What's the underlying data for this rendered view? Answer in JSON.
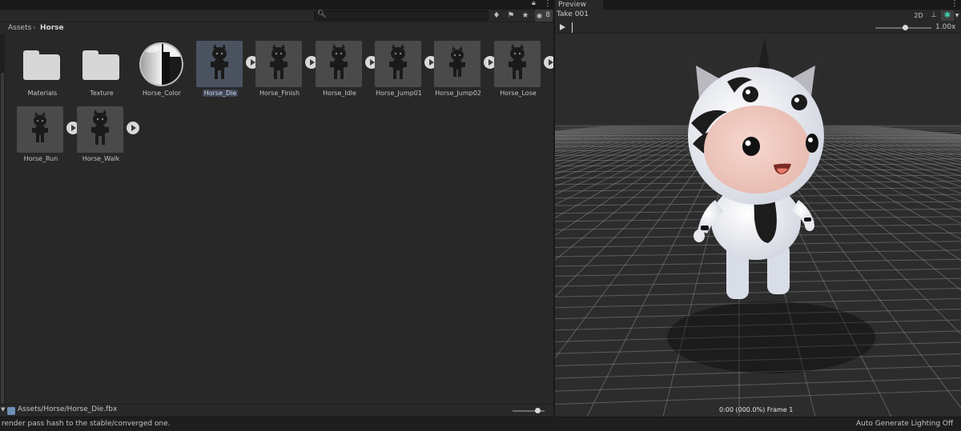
{
  "project": {
    "search": {
      "placeholder": "",
      "value": ""
    },
    "hidden_packages_count": "8",
    "breadcrumb": [
      "Assets",
      "Horse"
    ],
    "breadcrumb_separator": "›",
    "assets": [
      {
        "name": "Materials",
        "kind": "folder",
        "icon": "folder-icon"
      },
      {
        "name": "Texture",
        "kind": "folder",
        "icon": "folder-icon"
      },
      {
        "name": "Horse_Color",
        "kind": "material",
        "icon": "material-sphere-icon"
      },
      {
        "name": "Horse_Die",
        "kind": "model",
        "selected": true,
        "icon": "model-icon"
      },
      {
        "name": "Horse_Finish",
        "kind": "model",
        "icon": "model-icon"
      },
      {
        "name": "Horse_Idle",
        "kind": "model",
        "icon": "model-icon"
      },
      {
        "name": "Horse_Jump01",
        "kind": "model",
        "icon": "model-icon"
      },
      {
        "name": "Horse_Jump02",
        "kind": "model",
        "icon": "model-icon"
      },
      {
        "name": "Horse_Lose",
        "kind": "model",
        "icon": "model-icon"
      },
      {
        "name": "Horse_Run",
        "kind": "model",
        "icon": "model-icon"
      },
      {
        "name": "Horse_Walk",
        "kind": "model",
        "icon": "model-icon"
      }
    ],
    "footer_path": "Assets/Horse/Horse_Die.fbx"
  },
  "preview": {
    "tab_label": "Preview",
    "take_name": "Take 001",
    "btn_2d": "2D",
    "playback_speed": "1.00x",
    "frame_info": "0:00 (000.0%) Frame 1"
  },
  "status": {
    "message": "render pass hash to the stable/converged one.",
    "lighting": "Auto Generate Lighting Off"
  },
  "colors": {
    "panel_bg": "#282828",
    "selection": "#3a4457",
    "avatar_accent": "#3fd0a9"
  }
}
